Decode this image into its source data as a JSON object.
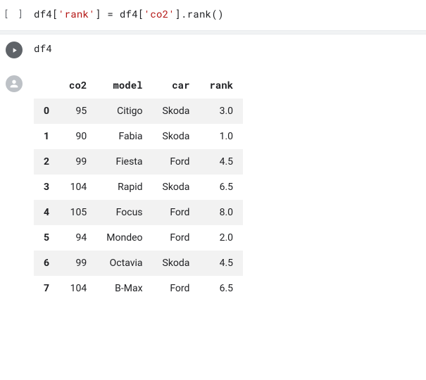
{
  "cell1": {
    "prompt": "[ ]",
    "code_prefix": "df4[",
    "code_str1": "'rank'",
    "code_mid": "] = df4[",
    "code_str2": "'co2'",
    "code_suffix": "].rank()"
  },
  "cell2": {
    "code": "df4"
  },
  "table": {
    "columns": [
      "co2",
      "model",
      "car",
      "rank"
    ],
    "rows": [
      {
        "idx": "0",
        "co2": "95",
        "model": "Citigo",
        "car": "Skoda",
        "rank": "3.0"
      },
      {
        "idx": "1",
        "co2": "90",
        "model": "Fabia",
        "car": "Skoda",
        "rank": "1.0"
      },
      {
        "idx": "2",
        "co2": "99",
        "model": "Fiesta",
        "car": "Ford",
        "rank": "4.5"
      },
      {
        "idx": "3",
        "co2": "104",
        "model": "Rapid",
        "car": "Skoda",
        "rank": "6.5"
      },
      {
        "idx": "4",
        "co2": "105",
        "model": "Focus",
        "car": "Ford",
        "rank": "8.0"
      },
      {
        "idx": "5",
        "co2": "94",
        "model": "Mondeo",
        "car": "Ford",
        "rank": "2.0"
      },
      {
        "idx": "6",
        "co2": "99",
        "model": "Octavia",
        "car": "Skoda",
        "rank": "4.5"
      },
      {
        "idx": "7",
        "co2": "104",
        "model": "B-Max",
        "car": "Ford",
        "rank": "6.5"
      }
    ]
  }
}
